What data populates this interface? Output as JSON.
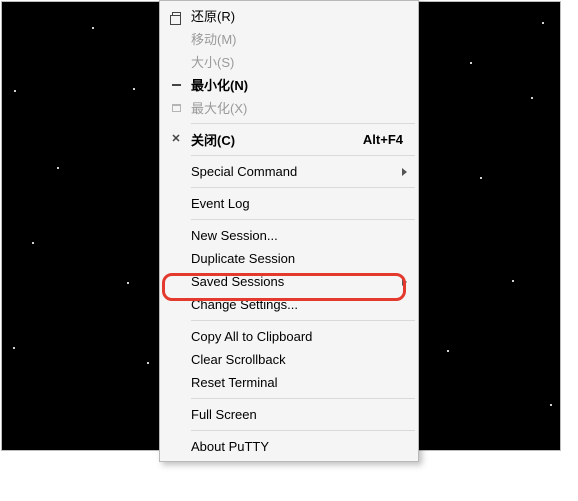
{
  "menu": {
    "restore": {
      "label": "还原(R)"
    },
    "move": {
      "label": "移动(M)"
    },
    "size": {
      "label": "大小(S)"
    },
    "minimize": {
      "label": "最小化(N)"
    },
    "maximize": {
      "label": "最大化(X)"
    },
    "close": {
      "label": "关闭(C)",
      "accel": "Alt+F4"
    },
    "special_command": {
      "label": "Special Command"
    },
    "event_log": {
      "label": "Event Log"
    },
    "new_session": {
      "label": "New Session..."
    },
    "duplicate_session": {
      "label": "Duplicate Session"
    },
    "saved_sessions": {
      "label": "Saved Sessions"
    },
    "change_settings": {
      "label": "Change Settings..."
    },
    "copy_all": {
      "label": "Copy All to Clipboard"
    },
    "clear_scrollback": {
      "label": "Clear Scrollback"
    },
    "reset_terminal": {
      "label": "Reset Terminal"
    },
    "full_screen": {
      "label": "Full Screen"
    },
    "about": {
      "label": "About PuTTY"
    }
  },
  "highlight": {
    "target": "change_settings"
  }
}
